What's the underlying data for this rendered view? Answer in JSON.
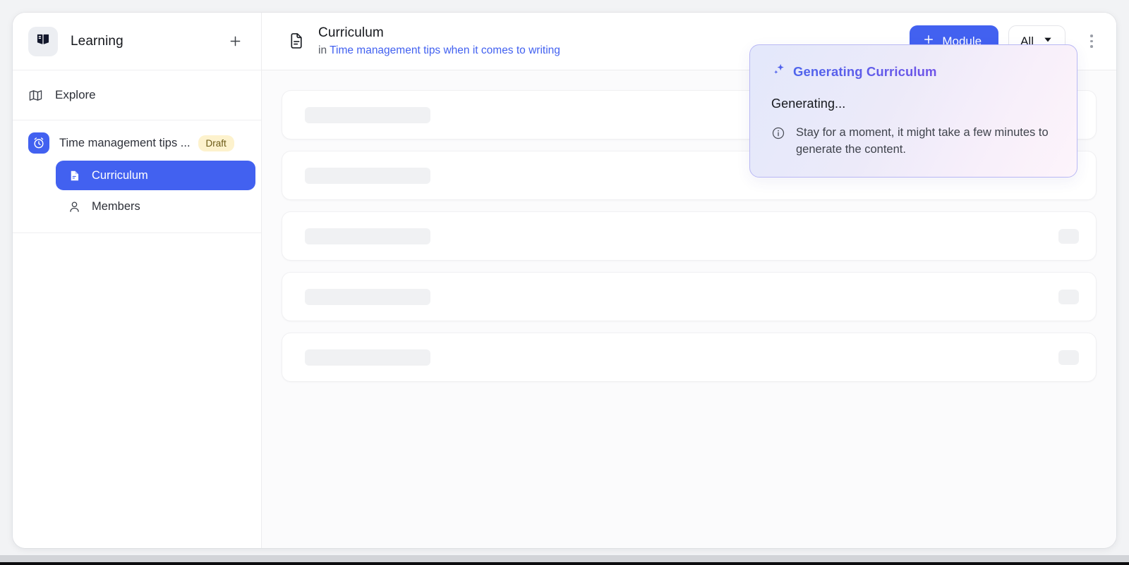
{
  "sidebar": {
    "brand": {
      "name": "Learning",
      "icon": "open-book-icon"
    },
    "add_label": "+",
    "explore": {
      "label": "Explore",
      "icon": "map-icon"
    },
    "course": {
      "title": "Time management tips ...",
      "badge": "Draft",
      "icon": "alarm-clock-icon",
      "items": [
        {
          "label": "Curriculum",
          "icon": "document-icon",
          "active": true
        },
        {
          "label": "Members",
          "icon": "person-icon",
          "active": false
        }
      ]
    }
  },
  "header": {
    "icon": "document-text-icon",
    "title": "Curriculum",
    "breadcrumb_prefix": "in",
    "breadcrumb_link": "Time management tips when it comes to writing",
    "add_module_label": "Module",
    "filter_label": "All",
    "more_label": "⋮"
  },
  "popup": {
    "title": "Generating Curriculum",
    "title_icon": "sparkle-icon",
    "status": "Generating...",
    "note_icon": "info-circle-icon",
    "note": "Stay for a moment, it might take a few minutes to generate the content."
  },
  "content": {
    "skeleton_rows": [
      {
        "has_chip": false
      },
      {
        "has_chip": false
      },
      {
        "has_chip": true
      },
      {
        "has_chip": true
      },
      {
        "has_chip": true
      }
    ]
  },
  "colors": {
    "accent": "#4261f0",
    "badge_bg": "#fdf2cd",
    "popup_border": "#b9b8f4",
    "page_bg": "#f2f3f5"
  }
}
